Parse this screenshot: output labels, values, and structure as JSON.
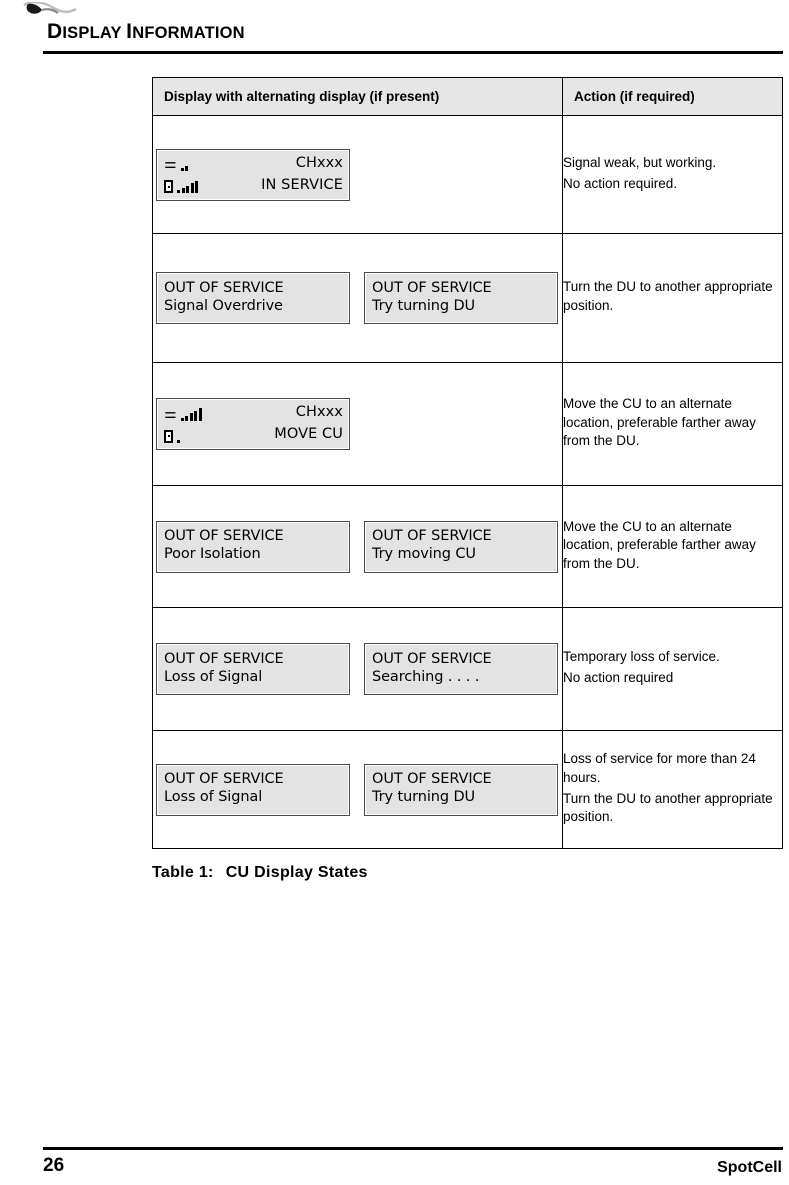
{
  "header": {
    "title_first_letter": "D",
    "title_rest1": "ISPLAY ",
    "title_letter2": "I",
    "title_rest2": "NFORMATION",
    "title_plain": "DISPLAY INFORMATION",
    "logo_name": "spotcell-swoosh-logo"
  },
  "table": {
    "columns": [
      {
        "label": "Display with alternating display (if present)"
      },
      {
        "label": "Action (if required)"
      }
    ],
    "rows": [
      {
        "kind": "signal",
        "display": {
          "antenna_bars": 2,
          "phone_bars": 5,
          "line1_right": "CHxxx",
          "line2_right": "IN SERVICE"
        },
        "action": [
          "Signal weak, but working.",
          "No action required."
        ]
      },
      {
        "kind": "status",
        "primary": {
          "line1": "OUT OF SERVICE",
          "line2": "Signal Overdrive"
        },
        "alternate": {
          "line1": "OUT OF SERVICE",
          "line2": "Try turning DU"
        },
        "action": [
          "Turn the DU to another appropriate position."
        ]
      },
      {
        "kind": "signal",
        "display": {
          "antenna_bars": 5,
          "phone_bars": 1,
          "line1_right": "CHxxx",
          "line2_right": "MOVE CU"
        },
        "action": [
          "Move the CU to an alternate location, preferable farther away from the DU."
        ]
      },
      {
        "kind": "status",
        "primary": {
          "line1": "OUT OF SERVICE",
          "line2": "Poor Isolation"
        },
        "alternate": {
          "line1": "OUT OF SERVICE",
          "line2": "Try moving CU"
        },
        "action": [
          "Move the CU to an alternate location, preferable farther away from the DU."
        ]
      },
      {
        "kind": "status",
        "primary": {
          "line1": "OUT OF SERVICE",
          "line2": "Loss of Signal"
        },
        "alternate": {
          "line1": "OUT OF SERVICE",
          "line2": "Searching . . . ."
        },
        "action": [
          "Temporary loss of service.",
          "No action required"
        ]
      },
      {
        "kind": "status",
        "primary": {
          "line1": "OUT OF SERVICE",
          "line2": "Loss of Signal"
        },
        "alternate": {
          "line1": "OUT OF SERVICE",
          "line2": "Try turning DU"
        },
        "action": [
          "Loss of service for more than 24 hours.",
          "Turn the DU to another appropriate position."
        ]
      }
    ],
    "caption_label": "Table 1:",
    "caption_text": "CU Display States"
  },
  "footer": {
    "page_number": "26",
    "brand": "SpotCell"
  },
  "colors": {
    "header_fill": "#e6e6e6",
    "lcd_fill": "#e3e3e3",
    "rule": "#000000"
  }
}
